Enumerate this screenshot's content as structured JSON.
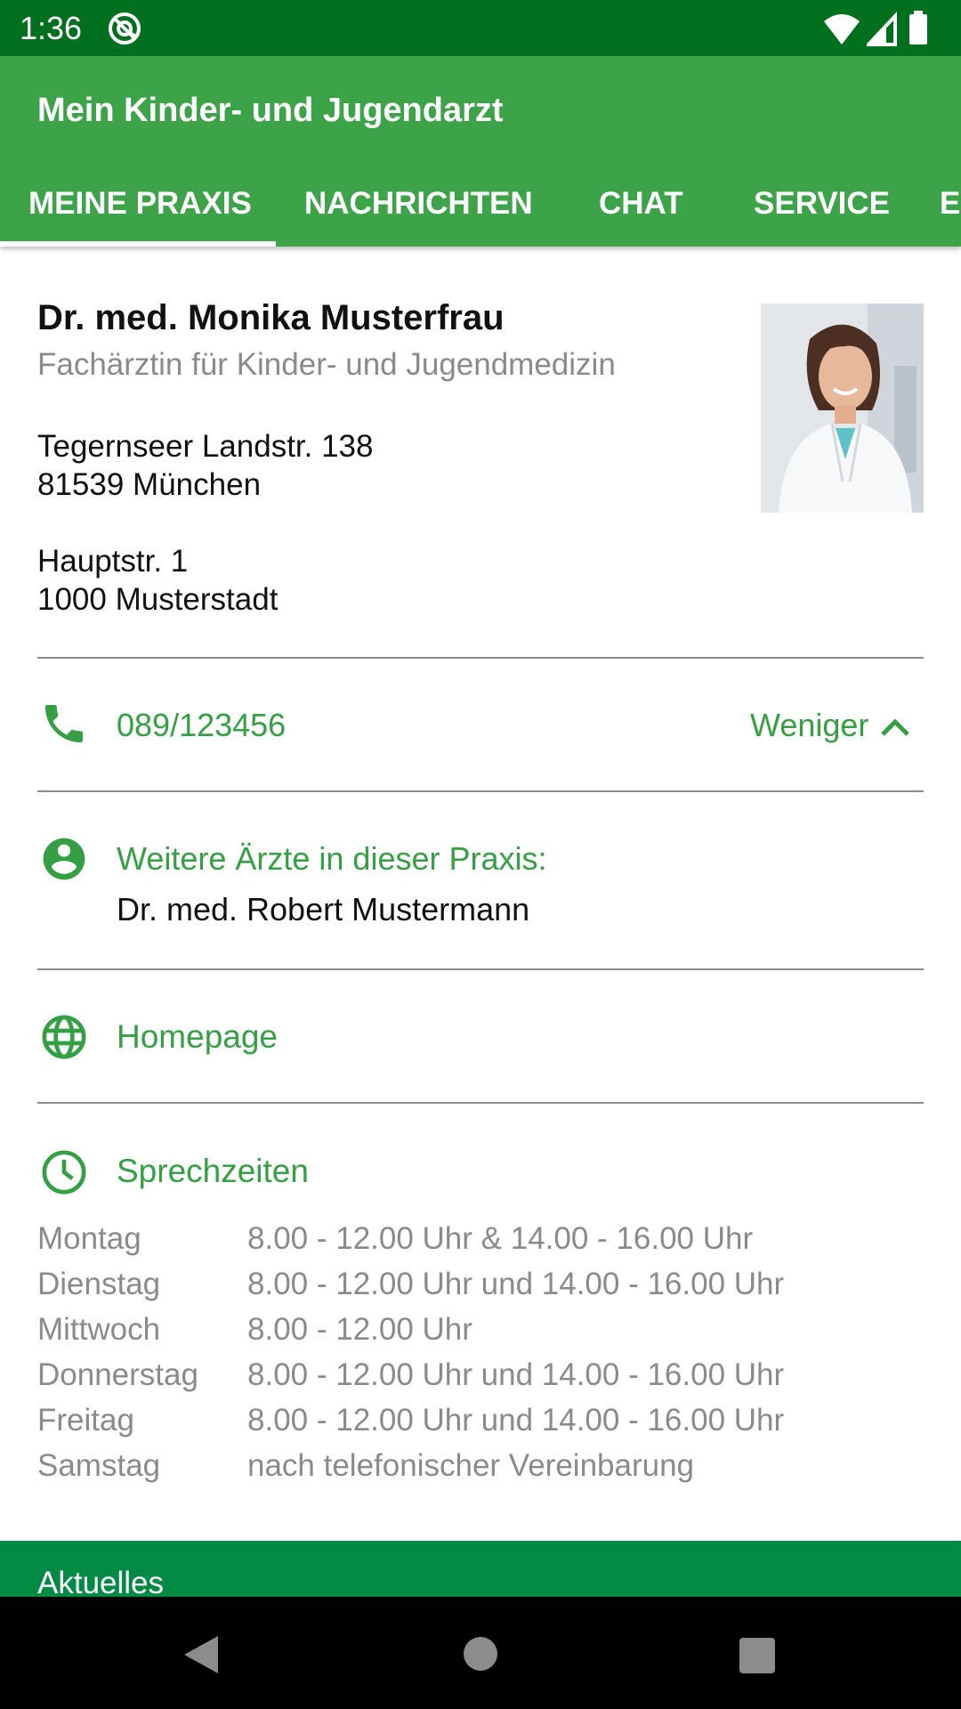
{
  "status_bar": {
    "time": "1:36",
    "left_icon": "at-sign-notification-icon",
    "right_icons": [
      "wifi-icon",
      "cell-signal-icon",
      "battery-icon"
    ]
  },
  "app_bar": {
    "title": "Mein Kinder- und Jugendarzt",
    "tabs": [
      {
        "label": "MEINE PRAXIS",
        "selected": true
      },
      {
        "label": "NACHRICHTEN",
        "selected": false
      },
      {
        "label": "CHAT",
        "selected": false
      },
      {
        "label": "SERVICE",
        "selected": false
      },
      {
        "label": "E",
        "selected": false
      }
    ]
  },
  "doctor": {
    "name": "Dr. med. Monika Musterfrau",
    "specialty": "Fachärztin für Kinder- und Jugendmedizin",
    "address1": {
      "street": "Tegernseer Landstr. 138",
      "city": "81539 München"
    },
    "address2": {
      "street": "Hauptstr. 1",
      "city": "1000 Musterstadt"
    }
  },
  "contact": {
    "phone": "089/123456",
    "toggle_label": "Weniger"
  },
  "more_doctors": {
    "label": "Weitere Ärzte in dieser Praxis:",
    "names": [
      "Dr. med. Robert Mustermann"
    ]
  },
  "homepage": {
    "label": "Homepage"
  },
  "hours": {
    "title": "Sprechzeiten",
    "rows": [
      {
        "day": "Montag",
        "time": "8.00 - 12.00 Uhr & 14.00 - 16.00 Uhr"
      },
      {
        "day": "Dienstag",
        "time": "8.00 - 12.00 Uhr und 14.00 - 16.00 Uhr"
      },
      {
        "day": "Mittwoch",
        "time": "8.00 - 12.00 Uhr"
      },
      {
        "day": "Donnerstag",
        "time": "8.00 - 12.00 Uhr und 14.00 - 16.00 Uhr"
      },
      {
        "day": "Freitag",
        "time": "8.00 - 12.00 Uhr und 14.00 - 16.00 Uhr"
      },
      {
        "day": "Samstag",
        "time": "nach telefonischer Vereinbarung"
      }
    ]
  },
  "news": {
    "title": "Aktuelles"
  },
  "colors": {
    "status_bar": "#00701f",
    "app_bar": "#3ca348",
    "accent_green": "#34a043",
    "news_bar": "#008a43"
  }
}
